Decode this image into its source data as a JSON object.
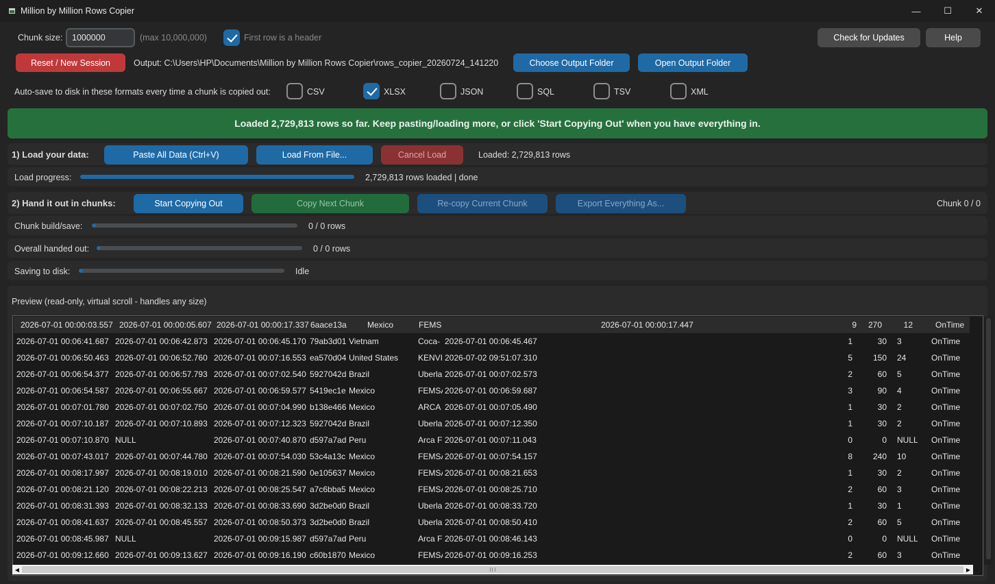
{
  "window": {
    "title": "Million by Million Rows Copier",
    "min": "—",
    "max": "☐",
    "close": "✕"
  },
  "top": {
    "chunk_size_label": "Chunk size:",
    "chunk_size_value": "1000000",
    "chunk_size_hint": "(max 10,000,000)",
    "header_checkbox_label": "First row is a header",
    "header_checked": true,
    "check_updates": "Check for Updates",
    "help": "Help"
  },
  "output": {
    "reset": "Reset / New Session",
    "path": "Output: C:\\Users\\HP\\Documents\\Million by Million Rows Copier\\rows_copier_20260724_141220",
    "choose": "Choose Output Folder",
    "open": "Open Output Folder"
  },
  "autosave": {
    "label": "Auto-save to disk in these formats every time a chunk is copied out:",
    "formats": [
      {
        "name": "CSV",
        "checked": false
      },
      {
        "name": "XLSX",
        "checked": true
      },
      {
        "name": "JSON",
        "checked": false
      },
      {
        "name": "SQL",
        "checked": false
      },
      {
        "name": "TSV",
        "checked": false
      },
      {
        "name": "XML",
        "checked": false
      }
    ]
  },
  "banner": "Loaded 2,729,813 rows so far. Keep pasting/loading more, or click 'Start Copying Out' when you have everything in.",
  "load": {
    "heading": "1) Load your data:",
    "paste": "Paste All Data (Ctrl+V)",
    "from_file": "Load From File...",
    "cancel": "Cancel Load",
    "status": "Loaded: 2,729,813 rows",
    "progress_label": "Load progress:",
    "progress_value": 1.0,
    "progress_text": "2,729,813 rows loaded  |  done"
  },
  "chunks": {
    "heading": "2) Hand it out in chunks:",
    "start": "Start Copying Out",
    "next": "Copy Next Chunk",
    "recopy": "Re-copy Current Chunk",
    "export": "Export Everything As...",
    "counter": "Chunk 0 / 0",
    "bars": [
      {
        "label": "Chunk build/save:",
        "value": 0.02,
        "text": "0 / 0 rows"
      },
      {
        "label": "Overall handed out:",
        "value": 0.02,
        "text": "0 / 0 rows"
      },
      {
        "label": "Saving to disk:",
        "value": 0.02,
        "text": "Idle"
      }
    ]
  },
  "preview": {
    "label": "Preview (read-only, virtual scroll - handles any size)",
    "header": [
      "2026-07-01 00:00:03.557",
      "2026-07-01 00:00:05.607",
      "2026-07-01 00:00:17.337",
      "6aace13a",
      "Mexico",
      "FEMS",
      "2026-07-01 00:00:17.447",
      "9",
      "270",
      "12",
      "OnTime"
    ],
    "rows": [
      [
        "2026-07-01 00:06:41.687",
        "2026-07-01 00:06:42.873",
        "2026-07-01 00:06:45.170",
        "79ab3d01",
        "Vietnam",
        "Coca-",
        "2026-07-01 00:06:45.467",
        "1",
        "30",
        "3",
        "OnTime"
      ],
      [
        "2026-07-01 00:06:50.463",
        "2026-07-01 00:06:52.760",
        "2026-07-01 00:07:16.553",
        "ea570d04",
        "United States",
        "KENVI",
        "2026-07-02 09:51:07.310",
        "5",
        "150",
        "24",
        "OnTime"
      ],
      [
        "2026-07-01 00:06:54.377",
        "2026-07-01 00:06:57.793",
        "2026-07-01 00:07:02.540",
        "5927042d",
        "Brazil",
        "Uberla",
        "2026-07-01 00:07:02.573",
        "2",
        "60",
        "5",
        "OnTime"
      ],
      [
        "2026-07-01 00:06:54.587",
        "2026-07-01 00:06:55.667",
        "2026-07-01 00:06:59.577",
        "5419ec1e",
        "Mexico",
        "FEMSA",
        "2026-07-01 00:06:59.687",
        "3",
        "90",
        "4",
        "OnTime"
      ],
      [
        "2026-07-01 00:07:01.780",
        "2026-07-01 00:07:02.750",
        "2026-07-01 00:07:04.990",
        "b138e466",
        "Mexico",
        "ARCA",
        "2026-07-01 00:07:05.490",
        "1",
        "30",
        "2",
        "OnTime"
      ],
      [
        "2026-07-01 00:07:10.187",
        "2026-07-01 00:07:10.893",
        "2026-07-01 00:07:12.323",
        "5927042d",
        "Brazil",
        "Uberla",
        "2026-07-01 00:07:12.350",
        "1",
        "30",
        "2",
        "OnTime"
      ],
      [
        "2026-07-01 00:07:10.870",
        "NULL",
        "2026-07-01 00:07:40.870",
        "d597a7ad",
        "Peru",
        "Arca F",
        "2026-07-01 00:07:11.043",
        "0",
        "0",
        "NULL",
        "OnTime"
      ],
      [
        "2026-07-01 00:07:43.017",
        "2026-07-01 00:07:44.780",
        "2026-07-01 00:07:54.030",
        "53c4a13c",
        "Mexico",
        "FEMSA",
        "2026-07-01 00:07:54.157",
        "8",
        "240",
        "10",
        "OnTime"
      ],
      [
        "2026-07-01 00:08:17.997",
        "2026-07-01 00:08:19.010",
        "2026-07-01 00:08:21.590",
        "0e105637",
        "Mexico",
        "FEMSA",
        "2026-07-01 00:08:21.653",
        "1",
        "30",
        "2",
        "OnTime"
      ],
      [
        "2026-07-01 00:08:21.120",
        "2026-07-01 00:08:22.213",
        "2026-07-01 00:08:25.547",
        "a7c6bba5",
        "Mexico",
        "FEMSA",
        "2026-07-01 00:08:25.710",
        "2",
        "60",
        "3",
        "OnTime"
      ],
      [
        "2026-07-01 00:08:31.393",
        "2026-07-01 00:08:32.133",
        "2026-07-01 00:08:33.690",
        "3d2be0d0",
        "Brazil",
        "Uberla",
        "2026-07-01 00:08:33.720",
        "1",
        "30",
        "1",
        "OnTime"
      ],
      [
        "2026-07-01 00:08:41.637",
        "2026-07-01 00:08:45.557",
        "2026-07-01 00:08:50.373",
        "3d2be0d0",
        "Brazil",
        "Uberla",
        "2026-07-01 00:08:50.410",
        "2",
        "60",
        "5",
        "OnTime"
      ],
      [
        "2026-07-01 00:08:45.987",
        "NULL",
        "2026-07-01 00:09:15.987",
        "d597a7ad",
        "Peru",
        "Arca F",
        "2026-07-01 00:08:46.143",
        "0",
        "0",
        "NULL",
        "OnTime"
      ],
      [
        "2026-07-01 00:09:12.660",
        "2026-07-01 00:09:13.627",
        "2026-07-01 00:09:16.190",
        "c60b1870",
        "Mexico",
        "FEMSA",
        "2026-07-01 00:09:16.253",
        "2",
        "60",
        "3",
        "OnTime"
      ]
    ]
  }
}
